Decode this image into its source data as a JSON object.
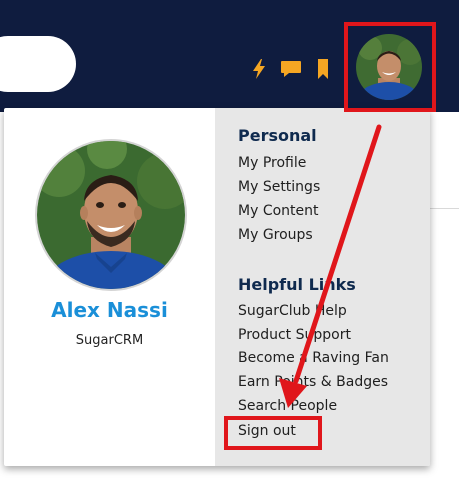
{
  "header": {
    "icons": [
      "lightning-icon",
      "chat-icon",
      "bookmark-icon"
    ],
    "accent_color": "#f5a623",
    "background_color": "#0f1c3f"
  },
  "profile": {
    "name": "Alex Nassi",
    "organization": "SugarCRM",
    "name_color": "#1a8fd8"
  },
  "personal": {
    "heading": "Personal",
    "links": [
      "My Profile",
      "My Settings",
      "My Content",
      "My Groups"
    ]
  },
  "helpful": {
    "heading": "Helpful Links",
    "links": [
      "SugarClub Help",
      "Product Support",
      "Become a Raving Fan",
      "Earn Points & Badges",
      "Search People"
    ]
  },
  "sign_out": "Sign out",
  "annotation_color": "#e0161b"
}
